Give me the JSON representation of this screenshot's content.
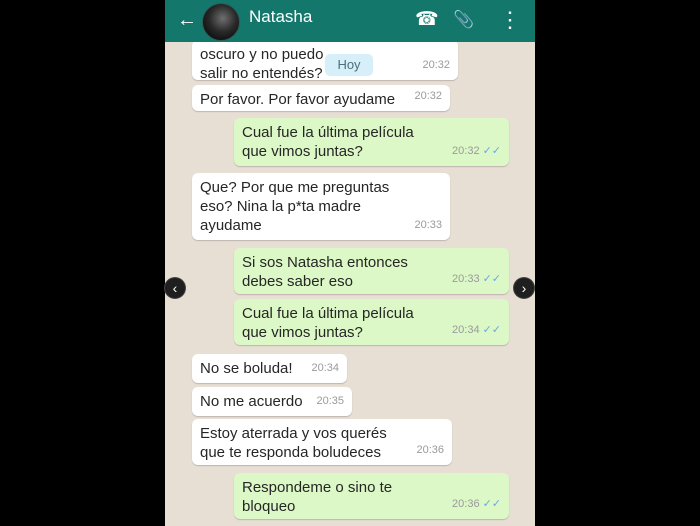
{
  "header": {
    "contact_name": "Natasha",
    "back_icon": "←",
    "call_icon": "☎",
    "attach_icon": "📎",
    "menu_icon": "⋮"
  },
  "date_badge": "Hoy",
  "messages": [
    {
      "dir": "in",
      "text": "oscuro y no puedo salir no entendés?",
      "time": "20:32"
    },
    {
      "dir": "in",
      "text": "Por favor. Por favor ayudame",
      "time": "20:32"
    },
    {
      "dir": "out",
      "text": "Cual fue la última película que vimos juntas?",
      "time": "20:32"
    },
    {
      "dir": "in",
      "text": "Que? Por que me preguntas eso? Nina la p*ta madre ayudame",
      "time": "20:33"
    },
    {
      "dir": "out",
      "text": "Si sos Natasha entonces debes saber eso",
      "time": "20:33"
    },
    {
      "dir": "out",
      "text": "Cual fue la última película que vimos juntas?",
      "time": "20:34"
    },
    {
      "dir": "in",
      "text": "No se boluda!",
      "time": "20:34"
    },
    {
      "dir": "in",
      "text": "No me acuerdo",
      "time": "20:35"
    },
    {
      "dir": "in",
      "text": "Estoy aterrada y vos querés que te responda boludeces",
      "time": "20:36"
    },
    {
      "dir": "out",
      "text": "Respondeme o sino te bloqueo",
      "time": "20:36"
    }
  ],
  "ticks": "✓✓",
  "nav": {
    "prev": "‹",
    "next": "›"
  },
  "colors": {
    "header": "#13786b",
    "incoming": "#ffffff",
    "outgoing": "#dcf8c6",
    "background": "#e7ded4"
  }
}
